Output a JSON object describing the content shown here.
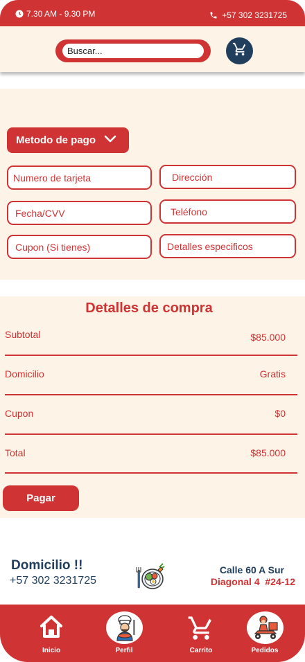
{
  "topbar": {
    "hours": "7.30 AM - 9.30 PM",
    "phone": "+57 302 3231725"
  },
  "search": {
    "placeholder": "Buscar..."
  },
  "payment": {
    "method_label": "Metodo de pago",
    "fields": {
      "card_number": "Numero de tarjeta",
      "address": "Dirección",
      "date_cvv": "Fecha/CVV",
      "phone": "Teléfono",
      "coupon": "Cupon (Si tienes)",
      "details": "Detalles especificos"
    }
  },
  "purchase": {
    "title": "Detalles de compra",
    "rows": [
      {
        "label": "Subtotal",
        "value": "$85.000"
      },
      {
        "label": "Domicilio",
        "value": "Gratis"
      },
      {
        "label": "Cupon",
        "value": "$0"
      },
      {
        "label": "Total",
        "value": "$85.000"
      }
    ],
    "pay_label": "Pagar"
  },
  "delivery": {
    "title": "Domicilio !!",
    "phone": "+57 302 3231725",
    "address_line1": "Calle 60 A Sur",
    "address_line2": "Diagonal 4  #24-12"
  },
  "nav": [
    {
      "label": "Inicio",
      "icon": "home-icon"
    },
    {
      "label": "Perfil",
      "icon": "chef-icon"
    },
    {
      "label": "Carrito",
      "icon": "cart-icon"
    },
    {
      "label": "Pedidos",
      "icon": "delivery-scooter-icon"
    }
  ],
  "colors": {
    "primary": "#d03333",
    "dark_blue": "#213e5d",
    "cream": "#fdf3e7"
  }
}
